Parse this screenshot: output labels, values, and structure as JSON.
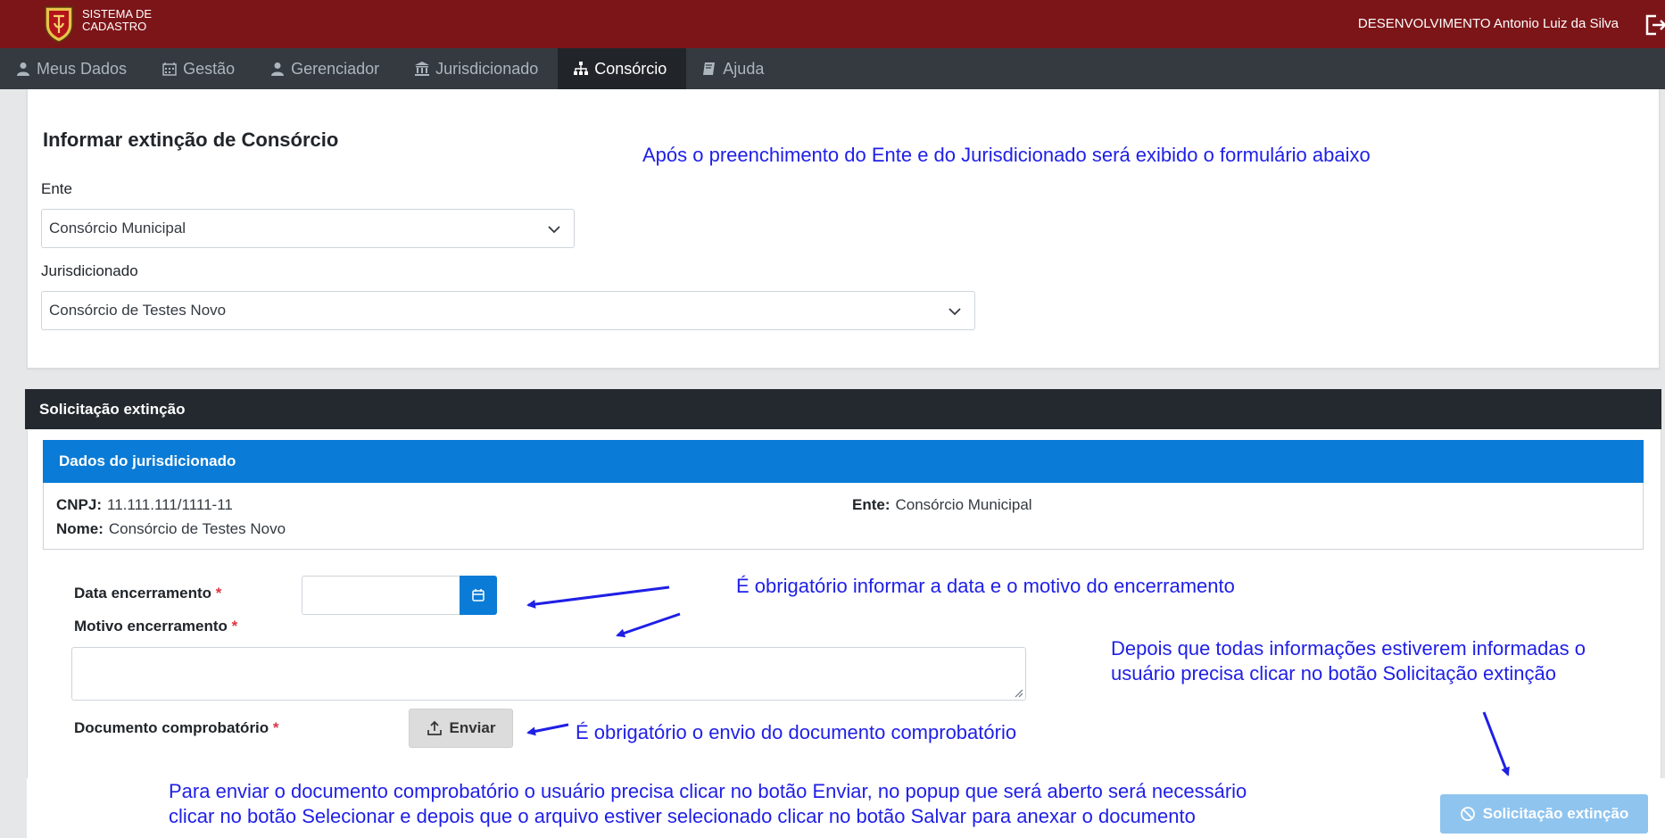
{
  "header": {
    "brand_line1": "SISTEMA DE",
    "brand_line2": "CADASTRO",
    "user": "DESENVOLVIMENTO Antonio Luiz da Silva",
    "bar_color": "#7c1518"
  },
  "nav": {
    "items": [
      {
        "label": "Meus Dados",
        "icon": "user-icon"
      },
      {
        "label": "Gestão",
        "icon": "calendar-icon"
      },
      {
        "label": "Gerenciador",
        "icon": "user-icon"
      },
      {
        "label": "Jurisdicionado",
        "icon": "institution-icon"
      },
      {
        "label": "Consórcio",
        "icon": "sitemap-icon",
        "active": true
      },
      {
        "label": "Ajuda",
        "icon": "book-icon"
      }
    ]
  },
  "form": {
    "title": "Informar extinção de Consórcio",
    "ente_label": "Ente",
    "ente_value": "Consórcio Municipal",
    "jurisdicionado_label": "Jurisdicionado",
    "jurisdicionado_value": "Consórcio de Testes Novo"
  },
  "solicitacao": {
    "header": "Solicitação extinção",
    "dados_header": "Dados do jurisdicionado",
    "cnpj_label": "CNPJ:",
    "cnpj_value": "11.111.111/1111-11",
    "nome_label": "Nome:",
    "nome_value": "Consórcio de Testes Novo",
    "ente_label": "Ente:",
    "ente_value": "Consórcio Municipal",
    "data_label": "Data encerramento",
    "motivo_label": "Motivo encerramento",
    "documento_label": "Documento comprobatório",
    "required_mark": "*",
    "enviar_label": "Enviar",
    "solicitar_label": "Solicitação extinção"
  },
  "annotations": {
    "a1": "Após o preenchimento do Ente e do Jurisdicionado será exibido o formulário abaixo",
    "a2": "É obrigatório informar a data e o motivo do encerramento",
    "a3_line1": "Depois que todas informações estiverem informadas o",
    "a3_line2": "usuário precisa clicar no botão Solicitação extinção",
    "a4": "É obrigatório o envio do documento comprobatório",
    "a5_line1": "Para enviar o documento comprobatório o usuário precisa clicar no botão Enviar, no popup que será aberto será necessário",
    "a5_line2": "clicar no botão Selecionar e depois que o arquivo estiver selecionado clicar no botão Salvar para anexar o documento",
    "color": "#1f1fe6"
  }
}
